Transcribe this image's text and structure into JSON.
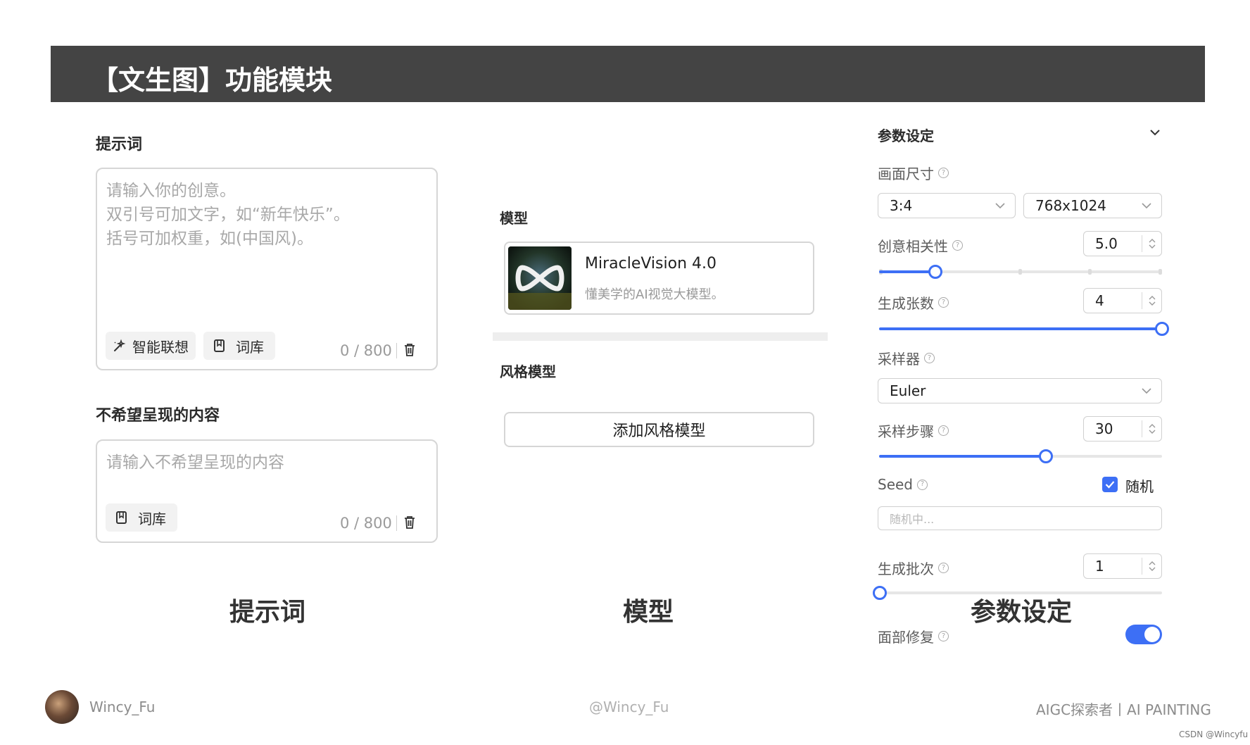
{
  "header": {
    "title": "【文生图】功能模块"
  },
  "prompt": {
    "section_label": "提示词",
    "placeholder_lines": [
      "请输入你的创意。",
      "双引号可加文字，如“新年快乐”。",
      "括号可加权重，如(中国风)。"
    ],
    "smart_button": "智能联想",
    "lexicon_button": "词库",
    "counter": "0 / 800"
  },
  "negative": {
    "section_label": "不希望呈现的内容",
    "placeholder": "请输入不希望呈现的内容",
    "lexicon_button": "词库",
    "counter": "0 / 800"
  },
  "model": {
    "section_label": "模型",
    "name": "MiracleVision 4.0",
    "description": "懂美学的AI视觉大模型。",
    "style_section_label": "风格模型",
    "add_style_button": "添加风格模型"
  },
  "params": {
    "title": "参数设定",
    "canvas_size_label": "画面尺寸",
    "aspect_ratio": "3:4",
    "resolution": "768x1024",
    "creativity_label": "创意相关性",
    "creativity_value": "5.0",
    "creativity_fraction": 0.2,
    "count_label": "生成张数",
    "count_value": "4",
    "count_fraction": 1.0,
    "sampler_label": "采样器",
    "sampler_value": "Euler",
    "steps_label": "采样步骤",
    "steps_value": "30",
    "steps_fraction": 0.59,
    "seed_label": "Seed",
    "random_label": "随机",
    "random_checked": true,
    "seed_placeholder": "随机中...",
    "batch_label": "生成批次",
    "batch_value": "1",
    "batch_fraction": 0.0,
    "face_fix_label": "面部修复",
    "face_fix_on": true
  },
  "captions": {
    "prompt": "提示词",
    "model": "模型",
    "params": "参数设定"
  },
  "footer": {
    "author": "Wincy_Fu",
    "handle": "@Wincy_Fu",
    "tagline": "AIGC探索者丨AI PAINTING",
    "watermark": "CSDN @Wincyfu"
  },
  "colors": {
    "header_bg": "#444444",
    "accent": "#3d6ff5",
    "border": "#d6d6d6"
  }
}
